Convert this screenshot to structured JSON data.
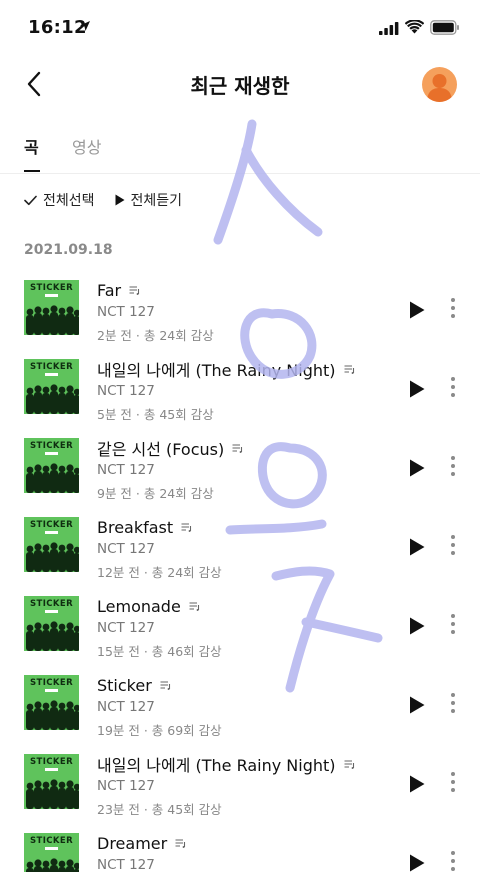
{
  "status_bar": {
    "time": "16:12"
  },
  "header": {
    "title": "최근 재생한"
  },
  "tabs": [
    {
      "label": "곡",
      "active": true
    },
    {
      "label": "영상",
      "active": false
    }
  ],
  "actions": {
    "select_all": "전체선택",
    "play_all": "전체듣기"
  },
  "date_group": "2021.09.18",
  "colors": {
    "album_green": "#5fc35c",
    "avatar_orange": "#f5a05c",
    "overlay_ink": "#b7b8f0"
  },
  "songs": [
    {
      "title": "Far",
      "artist": "NCT 127",
      "meta": "2분 전 · 총 24회 감상",
      "cover_text": "STICKER"
    },
    {
      "title": "내일의 나에게 (The Rainy Night)",
      "artist": "NCT 127",
      "meta": "5분 전 · 총 45회 감상",
      "cover_text": "STICKER"
    },
    {
      "title": "같은 시선 (Focus)",
      "artist": "NCT 127",
      "meta": "9분 전 · 총 24회 감상",
      "cover_text": "STICKER"
    },
    {
      "title": "Breakfast",
      "artist": "NCT 127",
      "meta": "12분 전 · 총 24회 감상",
      "cover_text": "STICKER"
    },
    {
      "title": "Lemonade",
      "artist": "NCT 127",
      "meta": "15분 전 · 총 46회 감상",
      "cover_text": "STICKER"
    },
    {
      "title": "Sticker",
      "artist": "NCT 127",
      "meta": "19분 전 · 총 69회 감상",
      "cover_text": "STICKER"
    },
    {
      "title": "내일의 나에게 (The Rainy Night)",
      "artist": "NCT 127",
      "meta": "23분 전 · 총 45회 감상",
      "cover_text": "STICKER"
    },
    {
      "title": "Dreamer",
      "artist": "NCT 127",
      "meta": "",
      "cover_text": "STICKER"
    }
  ]
}
